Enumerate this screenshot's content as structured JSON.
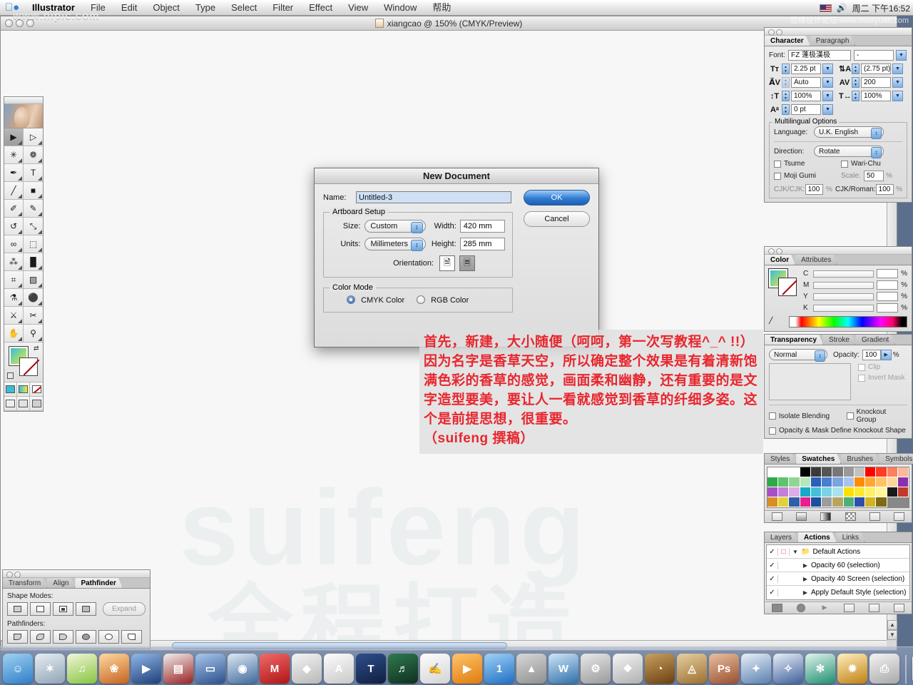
{
  "menubar": {
    "apple_icon": "apple-logo",
    "items": [
      "Illustrator",
      "File",
      "Edit",
      "Object",
      "Type",
      "Select",
      "Filter",
      "Effect",
      "View",
      "Window",
      "帮助"
    ],
    "right": {
      "flag_icon": "us-flag-icon",
      "speaker_icon": "volume-icon",
      "clock": "周二 下午16:52"
    }
  },
  "watermarks": {
    "top_left": "www.nipic.com",
    "top_right": "思缘设计论坛-www.missyuan.com",
    "canvas_line1": "suifeng",
    "canvas_line2": "全程打造"
  },
  "document": {
    "title": "xiangcao @ 150% (CMYK/Preview)",
    "doc_icon": "document-icon"
  },
  "toolbox": {
    "tools": [
      {
        "name": "selection-tool",
        "glyph": "▶",
        "selected": true
      },
      {
        "name": "direct-selection-tool",
        "glyph": "▷",
        "selected": false
      },
      {
        "name": "magic-wand-tool",
        "glyph": "✳",
        "selected": false
      },
      {
        "name": "lasso-tool",
        "glyph": "❁",
        "selected": false
      },
      {
        "name": "pen-tool",
        "glyph": "✒",
        "selected": false
      },
      {
        "name": "type-tool",
        "glyph": "T",
        "selected": false
      },
      {
        "name": "line-segment-tool",
        "glyph": "╱",
        "selected": false
      },
      {
        "name": "rectangle-tool",
        "glyph": "■",
        "selected": false
      },
      {
        "name": "paintbrush-tool",
        "glyph": "✐",
        "selected": false
      },
      {
        "name": "pencil-tool",
        "glyph": "✎",
        "selected": false
      },
      {
        "name": "rotate-tool",
        "glyph": "↺",
        "selected": false
      },
      {
        "name": "scale-tool",
        "glyph": "⤡",
        "selected": false
      },
      {
        "name": "warp-tool",
        "glyph": "∞",
        "selected": false
      },
      {
        "name": "free-transform-tool",
        "glyph": "⬚",
        "selected": false
      },
      {
        "name": "symbol-sprayer-tool",
        "glyph": "⁂",
        "selected": false
      },
      {
        "name": "column-graph-tool",
        "glyph": "█",
        "selected": false
      },
      {
        "name": "mesh-tool",
        "glyph": "⌗",
        "selected": false
      },
      {
        "name": "gradient-tool",
        "glyph": "▧",
        "selected": false
      },
      {
        "name": "eyedropper-tool",
        "glyph": "⚗",
        "selected": false
      },
      {
        "name": "blend-tool",
        "glyph": "⚫",
        "selected": false
      },
      {
        "name": "slice-tool",
        "glyph": "⚔",
        "selected": false
      },
      {
        "name": "scissors-tool",
        "glyph": "✂",
        "selected": false
      },
      {
        "name": "hand-tool",
        "glyph": "✋",
        "selected": false
      },
      {
        "name": "zoom-tool",
        "glyph": "⚲",
        "selected": false
      }
    ]
  },
  "character_panel": {
    "tabs": [
      {
        "label": "Character",
        "active": true
      },
      {
        "label": "Paragraph",
        "active": false
      }
    ],
    "font_label": "Font:",
    "font_family": "FZ 蓬极漢极",
    "font_style": "-",
    "size_icon": "font-size-icon",
    "size_value": "2.25 pt",
    "leading_icon": "leading-icon",
    "leading_value": "(2.75 pt)",
    "kerning_icon": "kerning-icon",
    "kerning_value": "Auto",
    "tracking_icon": "tracking-icon",
    "tracking_value": "200",
    "vscale_icon": "vertical-scale-icon",
    "vscale_value": "100%",
    "hscale_icon": "horizontal-scale-icon",
    "hscale_value": "100%",
    "baseline_icon": "baseline-shift-icon",
    "baseline_value": "0 pt",
    "multilingual": {
      "title": "Multilingual Options",
      "language_label": "Language:",
      "language_value": "U.K. English",
      "direction_label": "Direction:",
      "direction_value": "Rotate",
      "tsume_label": "Tsume",
      "warichu_label": "Wari-Chu",
      "mojigumi_label": "Moji Gumi",
      "scale_label": "Scale:",
      "scale_value": "50",
      "scale_unit": "%",
      "cjkcjk_label": "CJK/CJK:",
      "cjkcjk_value": "100",
      "cjkcjk_unit": "%",
      "cjkroman_label": "CJK/Roman:",
      "cjkroman_value": "100",
      "cjkroman_unit": "%"
    }
  },
  "color_panel": {
    "tabs": [
      {
        "label": "Color",
        "active": true
      },
      {
        "label": "Attributes",
        "active": false
      }
    ],
    "channels": [
      {
        "label": "C",
        "value": "",
        "unit": "%"
      },
      {
        "label": "M",
        "value": "",
        "unit": "%"
      },
      {
        "label": "Y",
        "value": "",
        "unit": "%"
      },
      {
        "label": "K",
        "value": "",
        "unit": "%"
      }
    ],
    "fill_color": "#39bcd6",
    "accent_fill_gradient_start": "#39bcd6",
    "accent_fill_gradient_end": "#e8ef3a",
    "none_marker": "none-stroke-icon"
  },
  "transparency_panel": {
    "tabs": [
      {
        "label": "Transparency",
        "active": true
      },
      {
        "label": "Stroke",
        "active": false
      },
      {
        "label": "Gradient",
        "active": false
      }
    ],
    "blend_mode": "Normal",
    "opacity_label": "Opacity:",
    "opacity_value": "100",
    "opacity_unit": "%",
    "clip_label": "Clip",
    "invert_mask_label": "Invert Mask",
    "isolate_blending_label": "Isolate Blending",
    "knockout_group_label": "Knockout Group",
    "knockout_shape_label": "Opacity & Mask Define Knockout Shape"
  },
  "swatches_panel": {
    "tabs": [
      {
        "label": "Styles",
        "active": false
      },
      {
        "label": "Swatches",
        "active": true
      },
      {
        "label": "Brushes",
        "active": false
      },
      {
        "label": "Symbols",
        "active": false
      }
    ],
    "colors": [
      "#ffffff",
      "#ffffff",
      "#ffffff",
      "#000000",
      "#3a3a3a",
      "#555555",
      "#777777",
      "#999999",
      "#c2c2c2",
      "#ff0000",
      "#ff3b24",
      "#ff7f5e",
      "#ffb79a",
      "#2faa46",
      "#5cc46a",
      "#8fd694",
      "#b8e6b8",
      "#2a5fbb",
      "#4a7fd0",
      "#7ba4e0",
      "#a9c4ec",
      "#ff8c00",
      "#ffa733",
      "#ffc266",
      "#ffd699",
      "#8a2fb0",
      "#a94fc8",
      "#c47fd8",
      "#dcaee8",
      "#18a8c8",
      "#45c0d8",
      "#7ad3e4",
      "#a9e2ee",
      "#ffe000",
      "#ffe933",
      "#fff066",
      "#fff799",
      "#1a1a1a",
      "#c0392b",
      "#d98f1f",
      "#e2d23a",
      "#2f5fa8",
      "#e91e8c",
      "#1b4fa0",
      "#9c9c9c",
      "#b9a45e",
      "#4caf7a",
      "#2f4fae",
      "#d4b41e",
      "#7e6b12"
    ],
    "footer_icons": [
      "swatch-list-icon",
      "new-color-group-icon",
      "new-gradient-icon",
      "new-pattern-icon",
      "new-swatch-icon",
      "delete-swatch-icon"
    ]
  },
  "actions_panel": {
    "tabs": [
      {
        "label": "Layers",
        "active": false
      },
      {
        "label": "Actions",
        "active": true
      },
      {
        "label": "Links",
        "active": false
      }
    ],
    "rows": [
      {
        "check": "✓",
        "label": "Default Actions",
        "is_folder": true,
        "expanded": true
      },
      {
        "check": "✓",
        "label": "Opacity 60 (selection)",
        "is_folder": false,
        "expanded": false
      },
      {
        "check": "✓",
        "label": "Opacity 40 Screen (selection)",
        "is_folder": false,
        "expanded": false
      },
      {
        "check": "✓",
        "label": "Apply Default Style (selection)",
        "is_folder": false,
        "expanded": false
      }
    ],
    "footer_icons": [
      "stop-icon",
      "record-icon",
      "play-icon",
      "new-set-icon",
      "new-action-icon",
      "delete-action-icon"
    ]
  },
  "pathfinder_panel": {
    "tabs": [
      {
        "label": "Transform",
        "active": false
      },
      {
        "label": "Align",
        "active": false
      },
      {
        "label": "Pathfinder",
        "active": true
      }
    ],
    "shape_modes_label": "Shape Modes:",
    "shape_modes": [
      "add-to-shape-area",
      "subtract-from-shape-area",
      "intersect-shape-areas",
      "exclude-overlapping-shape-areas"
    ],
    "expand_label": "Expand",
    "pathfinders_label": "Pathfinders:",
    "pathfinders": [
      "divide",
      "trim",
      "merge",
      "crop",
      "outline",
      "minus-back"
    ]
  },
  "new_document_dialog": {
    "title": "New Document",
    "name_label": "Name:",
    "name_value": "Untitled-3",
    "ok_label": "OK",
    "cancel_label": "Cancel",
    "artboard_setup": {
      "legend": "Artboard Setup",
      "size_label": "Size:",
      "size_value": "Custom",
      "width_label": "Width:",
      "width_value": "420 mm",
      "units_label": "Units:",
      "units_value": "Millimeters",
      "height_label": "Height:",
      "height_value": "285 mm",
      "orientation_label": "Orientation:",
      "portrait_icon": "portrait-orientation-icon",
      "landscape_icon": "landscape-orientation-icon",
      "orientation_selected": "landscape"
    },
    "color_mode": {
      "legend": "Color Mode",
      "cmyk_label": "CMYK Color",
      "rgb_label": "RGB Color",
      "selected": "CMYK Color"
    }
  },
  "annotation": {
    "color": "#e8262e",
    "text": "首先，新建，大小随便（呵呵，第一次写教程^_^ !!）\n因为名字是香草天空，所以确定整个效果是有着清新饱满色彩的香草的感觉，画面柔和幽静，还有重要的是文字造型要美，要让人一看就感觉到香草的纤细多姿。这个是前提思想，很重要。\n（suifeng 撰稿）"
  },
  "dock": {
    "items": [
      {
        "name": "finder",
        "glyph": "☺",
        "color1": "#9fd2f2",
        "color2": "#2f7ec9",
        "running": true
      },
      {
        "name": "safari",
        "glyph": "✶",
        "color1": "#e8eef4",
        "color2": "#8fa3b5",
        "running": false
      },
      {
        "name": "itunes",
        "glyph": "♫",
        "color1": "#f2f7d8",
        "color2": "#86c43f",
        "running": true
      },
      {
        "name": "iphoto",
        "glyph": "❀",
        "color1": "#ffd9a0",
        "color2": "#c4641f",
        "running": false
      },
      {
        "name": "imovie",
        "glyph": "▶",
        "color1": "#8fb8e8",
        "color2": "#1f3f7a",
        "running": false
      },
      {
        "name": "final-cut-pro",
        "glyph": "▤",
        "color1": "#f0f0f0",
        "color2": "#9a2222",
        "running": false
      },
      {
        "name": "dvd-player",
        "glyph": "▭",
        "color1": "#a9c8ec",
        "color2": "#2b4f8c",
        "running": false
      },
      {
        "name": "quicktime",
        "glyph": "◉",
        "color1": "#dfe8f4",
        "color2": "#3f6a9c",
        "running": true
      },
      {
        "name": "maya",
        "glyph": "M",
        "color1": "#f06a6a",
        "color2": "#b01515",
        "running": false
      },
      {
        "name": "stuffit-expander",
        "glyph": "◆",
        "color1": "#f4f4f4",
        "color2": "#b8b8b8",
        "running": false
      },
      {
        "name": "appleworks",
        "glyph": "A",
        "color1": "#fdfdfd",
        "color2": "#c8c8c8",
        "running": false
      },
      {
        "name": "livetype",
        "glyph": "T",
        "color1": "#2f4f8f",
        "color2": "#101f3f",
        "running": false
      },
      {
        "name": "soundtrack",
        "glyph": "♬",
        "color1": "#2f7a4f",
        "color2": "#0f2f1f",
        "running": false
      },
      {
        "name": "textedit",
        "glyph": "✍",
        "color1": "#fdfdfd",
        "color2": "#d4d4d4",
        "running": false
      },
      {
        "name": "media-player",
        "glyph": "▶",
        "color1": "#ffc46a",
        "color2": "#e07b10",
        "running": false
      },
      {
        "name": "sherlock",
        "glyph": "1",
        "color1": "#9fd2f8",
        "color2": "#1f6fc4",
        "running": false
      },
      {
        "name": "vlc",
        "glyph": "▲",
        "color1": "#d8d8d8",
        "color2": "#8f8f8f",
        "running": false
      },
      {
        "name": "microsoft-word",
        "glyph": "W",
        "color1": "#cfe6f8",
        "color2": "#2f6fa8",
        "running": false
      },
      {
        "name": "system-preferences",
        "glyph": "⚙",
        "color1": "#e8e8e8",
        "color2": "#9a9a9a",
        "running": false
      },
      {
        "name": "apple-app",
        "glyph": "❖",
        "color1": "#f4f4f4",
        "color2": "#b0b0b0",
        "running": false
      },
      {
        "name": "clock-widget",
        "glyph": "◔",
        "color1": "#c8a060",
        "color2": "#6a3f10",
        "running": false
      },
      {
        "name": "classic-painting",
        "glyph": "◬",
        "color1": "#e8cfa0",
        "color2": "#9a7030",
        "running": false
      },
      {
        "name": "photoshop",
        "glyph": "Ps",
        "color1": "#e8c0a0",
        "color2": "#9a4f2f",
        "running": true
      },
      {
        "name": "illustrator-blue",
        "glyph": "✦",
        "color1": "#e8f0f8",
        "color2": "#5a7fb0",
        "running": false
      },
      {
        "name": "indesign",
        "glyph": "✧",
        "color1": "#e8f0f8",
        "color2": "#3f5f9a",
        "running": false
      },
      {
        "name": "imageready",
        "glyph": "✻",
        "color1": "#dff4ec",
        "color2": "#1f8f6f",
        "running": false
      },
      {
        "name": "illustrator",
        "glyph": "✹",
        "color1": "#fff0c0",
        "color2": "#c08010",
        "running": false
      },
      {
        "name": "printer",
        "glyph": "⎙",
        "color1": "#f4f4f4",
        "color2": "#a8a8a8",
        "running": false
      }
    ],
    "right_items": [
      {
        "name": "documents-folder",
        "glyph": "▤",
        "color1": "#ffffff",
        "color2": "#c8d4e0"
      },
      {
        "name": "music-folder",
        "glyph": "♪",
        "color1": "#ffffff",
        "color2": "#c8d4e0"
      },
      {
        "name": "trash",
        "glyph": "□",
        "color1": "#d8d8d8",
        "color2": "#8a8a8a"
      }
    ]
  }
}
